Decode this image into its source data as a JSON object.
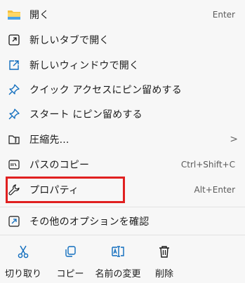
{
  "menu": {
    "items": [
      {
        "label": "開く",
        "shortcut": "Enter",
        "icon": "folder-icon"
      },
      {
        "label": "新しいタブで開く",
        "shortcut": "",
        "icon": "open-in-tab-icon"
      },
      {
        "label": "新しいウィンドウで開く",
        "shortcut": "",
        "icon": "open-in-window-icon"
      },
      {
        "label": "クイック アクセスにピン留めする",
        "shortcut": "",
        "icon": "pin-icon"
      },
      {
        "label": "スタート にピン留めする",
        "shortcut": "",
        "icon": "pin-icon"
      },
      {
        "label": "圧縮先...",
        "shortcut": "",
        "icon": "compress-icon",
        "has_submenu": true
      },
      {
        "label": "パスのコピー",
        "shortcut": "Ctrl+Shift+C",
        "icon": "copy-path-icon"
      },
      {
        "label": "プロパティ",
        "shortcut": "Alt+Enter",
        "icon": "wrench-icon"
      },
      {
        "label": "その他のオプションを確認",
        "shortcut": "",
        "icon": "more-options-icon"
      }
    ],
    "submenu_glyph": ">"
  },
  "actions": [
    {
      "label": "切り取り",
      "icon": "scissors-icon"
    },
    {
      "label": "コピー",
      "icon": "copy-icon"
    },
    {
      "label": "名前の変更",
      "icon": "rename-icon"
    },
    {
      "label": "削除",
      "icon": "trash-icon"
    }
  ],
  "colors": {
    "accent": "#0f6cbd",
    "highlight_border": "#e02020",
    "folder": "#f4c03f"
  }
}
